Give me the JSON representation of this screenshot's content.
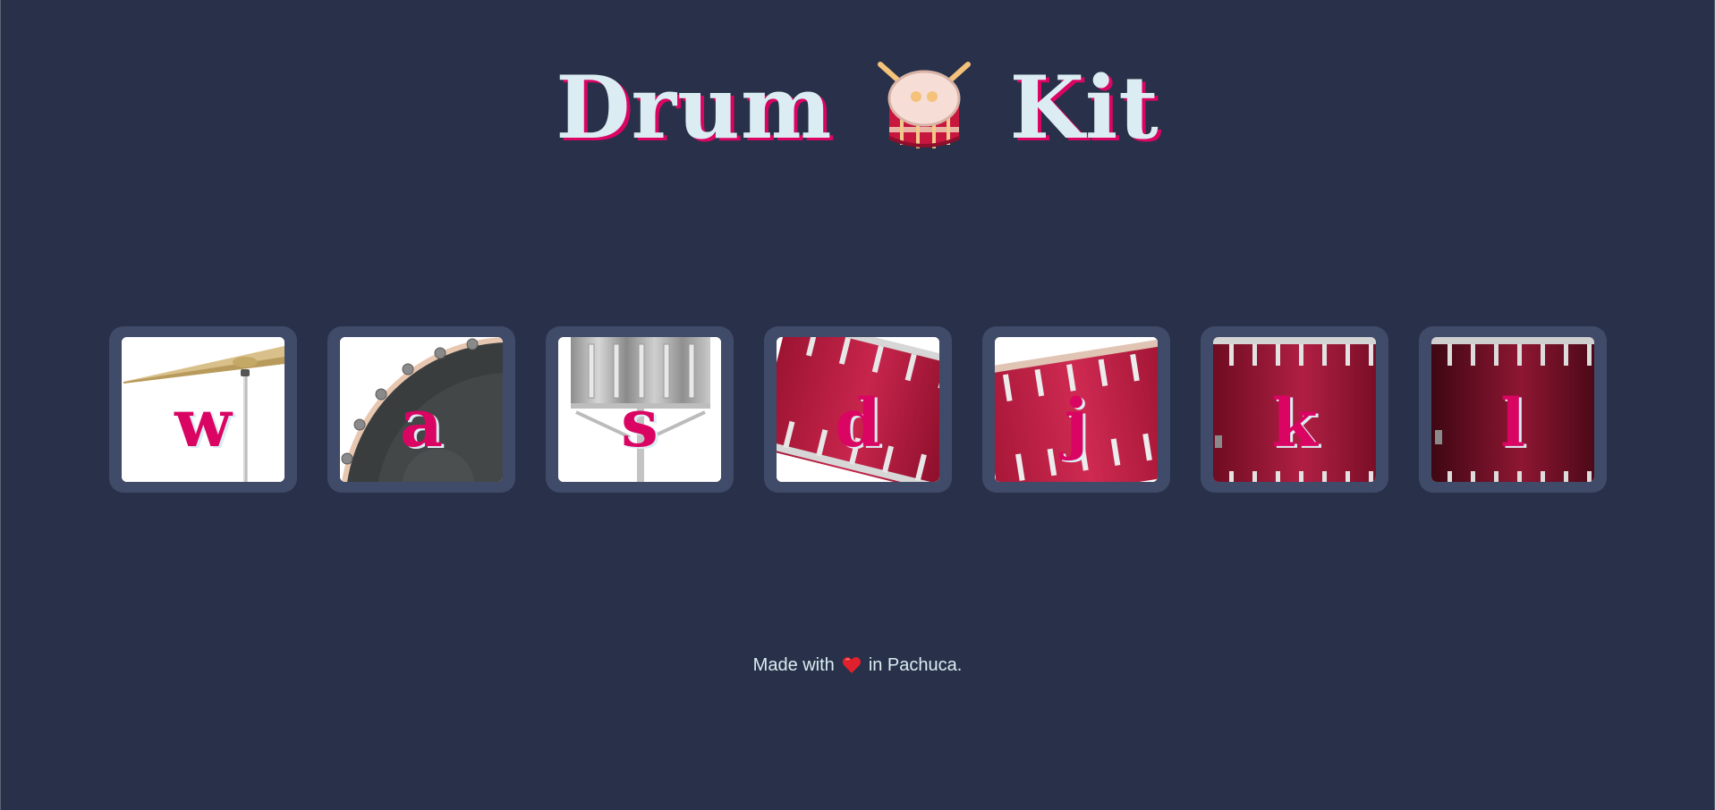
{
  "header": {
    "title_left": "Drum",
    "title_right": "Kit",
    "title_icon": "drum-icon"
  },
  "pads": [
    {
      "key": "w",
      "instrument_icon": "crash-cymbal-icon"
    },
    {
      "key": "a",
      "instrument_icon": "bass-drum-icon"
    },
    {
      "key": "s",
      "instrument_icon": "snare-drum-icon"
    },
    {
      "key": "d",
      "instrument_icon": "tom-tom-1-icon"
    },
    {
      "key": "j",
      "instrument_icon": "tom-tom-2-icon"
    },
    {
      "key": "k",
      "instrument_icon": "tom-tom-3-icon"
    },
    {
      "key": "l",
      "instrument_icon": "tom-tom-4-icon"
    }
  ],
  "footer": {
    "before": "Made with",
    "icon": "heart-icon",
    "after": "in Pachuca."
  },
  "colors": {
    "background": "#283149",
    "pad_frame": "#404b69",
    "accent": "#da0463",
    "text": "#dbedf3",
    "drum_red": "#b3143b"
  }
}
